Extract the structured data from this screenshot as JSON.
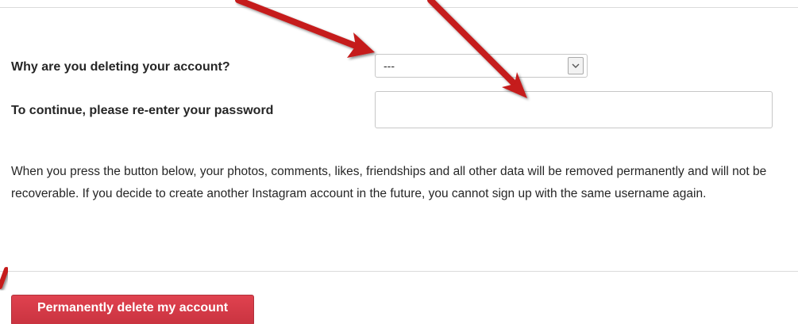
{
  "form": {
    "reason_label": "Why are you deleting your account?",
    "reason_select_value": "---",
    "password_label": "To continue, please re-enter your password",
    "password_value": ""
  },
  "info": {
    "text": "When you press the button below, your photos, comments, likes, friendships and all other data will be removed permanently and will not be recoverable. If you decide to create another Instagram account in the future, you cannot sign up with the same username again."
  },
  "actions": {
    "delete_label": "Permanently delete my account"
  },
  "colors": {
    "button": "#d63a46",
    "annotation_arrow": "#c51a1a",
    "divider": "#dbdbdb"
  },
  "icons": {
    "select_arrow": "chevron-down-icon",
    "annotation": "red-arrow-icon"
  }
}
